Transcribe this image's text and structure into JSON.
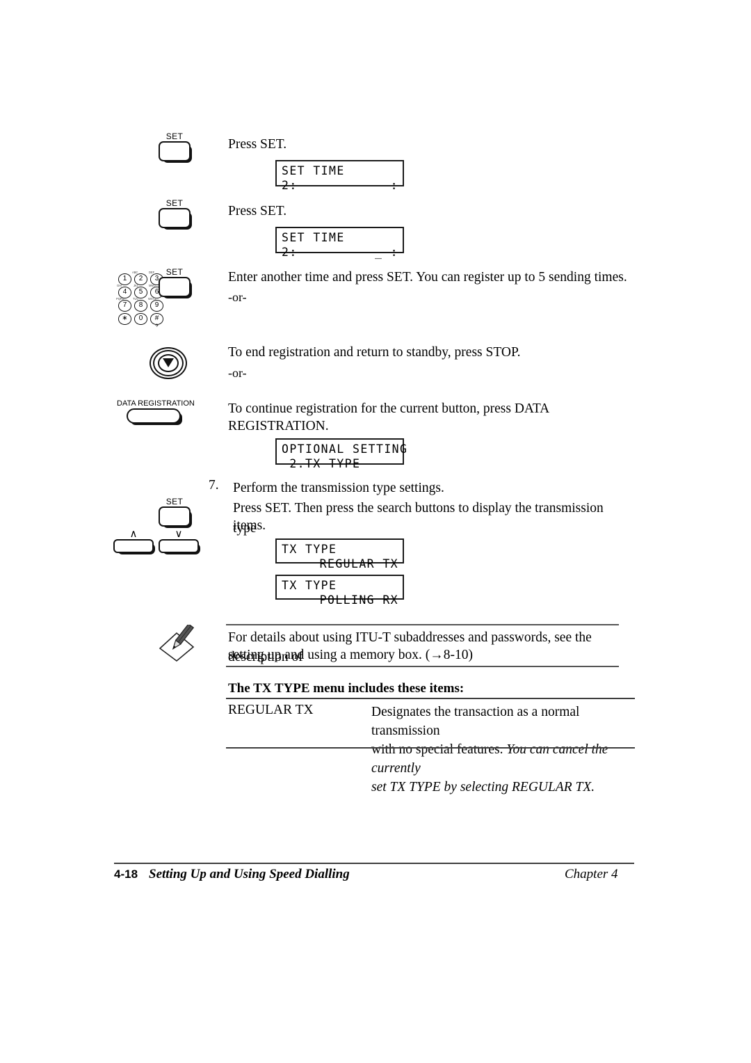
{
  "page": {
    "footer": {
      "page_number": "4-18",
      "title": "Setting Up and Using Speed Dialling",
      "chapter": "Chapter 4"
    }
  },
  "steps": [
    {
      "id": "press-set-1",
      "instruction": "Press SET.",
      "button_label": "SET"
    },
    {
      "id": "press-set-2",
      "instruction": "Press SET.",
      "button_label": "SET"
    },
    {
      "id": "enter-another-time",
      "instruction": "Enter another time and press SET. You can register up to 5 sending times.",
      "or": "-or-",
      "button_label": "SET"
    },
    {
      "id": "end-registration",
      "instruction": "To end registration and return to standby, press STOP.",
      "or": "-or-"
    },
    {
      "id": "continue-registration",
      "instruction_line1": "To continue registration for the current button, press DATA",
      "instruction_line2": "REGISTRATION.",
      "button_label": "DATA REGISTRATION"
    },
    {
      "id": "transmission-type",
      "number": "7.",
      "instruction": "Perform the transmission type settings.",
      "detail_line1": "Press SET. Then press the search buttons to display the transmission type",
      "detail_line2": "items.",
      "button_label": "SET",
      "search_up": "∧",
      "search_down": "∨"
    }
  ],
  "lcd_displays": [
    {
      "id": "set-time-1",
      "line1": "SET TIME",
      "line2_left": "2:",
      "line2_right": ":"
    },
    {
      "id": "set-time-2",
      "line1": "SET TIME",
      "line2_left": "2:",
      "line2_right": "_ :"
    },
    {
      "id": "optional-setting",
      "line1": "OPTIONAL SETTING",
      "line2_left": " 2.TX TYPE",
      "line2_right": ""
    },
    {
      "id": "tx-type-regular",
      "line1": "TX TYPE",
      "line2_left": "",
      "line2_right": "REGULAR TX"
    },
    {
      "id": "tx-type-polling",
      "line1": "TX TYPE",
      "line2_left": "",
      "line2_right": "POLLING RX"
    }
  ],
  "note": {
    "icon": "pencil-note-icon",
    "line1": "For details about using ITU-T subaddresses and passwords, see the description of",
    "line2": "setting up and using a memory box. (→8-10)"
  },
  "menu_table": {
    "heading": "The TX TYPE menu includes these items:",
    "rows": [
      {
        "term": "REGULAR TX",
        "desc_line1": "Designates the transaction as a normal transmission",
        "desc_line2_plain": "with no special features. ",
        "desc_line2_italic": "You can cancel the currently",
        "desc_line3_italic": "set TX TYPE by selecting REGULAR TX."
      }
    ]
  },
  "keypad": {
    "keys": [
      {
        "label": "1",
        "sub": ""
      },
      {
        "label": "2",
        "sub": "ABC"
      },
      {
        "label": "3",
        "sub": "DEF"
      },
      {
        "label": "4",
        "sub": "GHI"
      },
      {
        "label": "5",
        "sub": "JKL"
      },
      {
        "label": "6",
        "sub": "MNO"
      },
      {
        "label": "7",
        "sub": "PQRS"
      },
      {
        "label": "8",
        "sub": "TUV"
      },
      {
        "label": "9",
        "sub": "WXYZ"
      },
      {
        "label": "∗",
        "sub": ""
      },
      {
        "label": "0",
        "sub": ""
      },
      {
        "label": "#",
        "sub": ""
      }
    ]
  }
}
